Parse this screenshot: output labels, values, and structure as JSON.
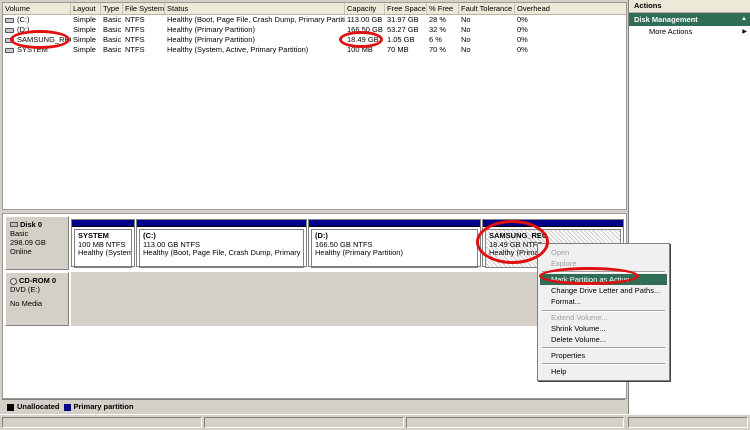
{
  "volumes_table": {
    "headers": [
      "Volume",
      "Layout",
      "Type",
      "File System",
      "Status",
      "Capacity",
      "Free Space",
      "% Free",
      "Fault Tolerance",
      "Overhead"
    ],
    "rows": [
      [
        "(C:)",
        "Simple",
        "Basic",
        "NTFS",
        "Healthy (Boot, Page File, Crash Dump, Primary Partition)",
        "113.00 GB",
        "31.97 GB",
        "28 %",
        "No",
        "0%"
      ],
      [
        "(D:)",
        "Simple",
        "Basic",
        "NTFS",
        "Healthy (Primary Partition)",
        "166.50 GB",
        "53.27 GB",
        "32 %",
        "No",
        "0%"
      ],
      [
        "SAMSUNG_REC",
        "Simple",
        "Basic",
        "NTFS",
        "Healthy (Primary Partition)",
        "18.49 GB",
        "1.05 GB",
        "6 %",
        "No",
        "0%"
      ],
      [
        "SYSTEM",
        "Simple",
        "Basic",
        "NTFS",
        "Healthy (System, Active, Primary Partition)",
        "100 MB",
        "70 MB",
        "70 %",
        "No",
        "0%"
      ]
    ]
  },
  "disk0": {
    "name": "Disk 0",
    "type": "Basic",
    "size": "298.09 GB",
    "state": "Online",
    "partitions": [
      {
        "name": "SYSTEM",
        "size": "100 MB NTFS",
        "status": "Healthy (System, A"
      },
      {
        "name": "(C:)",
        "size": "113.00 GB NTFS",
        "status": "Healthy (Boot, Page File, Crash Dump, Primary Partiti"
      },
      {
        "name": "(D:)",
        "size": "166.50 GB NTFS",
        "status": "Healthy (Primary Partition)"
      },
      {
        "name": "SAMSUNG_REC",
        "size": "18.49 GB NTFS",
        "status": "Healthy (Primary"
      }
    ]
  },
  "cdrom0": {
    "name": "CD-ROM 0",
    "type": "DVD (E:)",
    "media": "No Media"
  },
  "legend": [
    {
      "label": "Unallocated",
      "color": "#000000"
    },
    {
      "label": "Primary partition",
      "color": "#00008b"
    }
  ],
  "actions": {
    "header": "Actions",
    "section": "Disk Management",
    "more": "More Actions"
  },
  "context_menu": [
    {
      "label": "Open",
      "enabled": false
    },
    {
      "label": "Explore",
      "enabled": false
    },
    {
      "sep": true
    },
    {
      "label": "Mark Partition as Active",
      "enabled": true,
      "highlighted": true
    },
    {
      "label": "Change Drive Letter and Paths...",
      "enabled": true
    },
    {
      "label": "Format...",
      "enabled": true
    },
    {
      "sep": true
    },
    {
      "label": "Extend Volume...",
      "enabled": false
    },
    {
      "label": "Shrink Volume...",
      "enabled": true
    },
    {
      "label": "Delete Volume...",
      "enabled": true
    },
    {
      "sep": true
    },
    {
      "label": "Properties",
      "enabled": true
    },
    {
      "sep": true
    },
    {
      "label": "Help",
      "enabled": true
    }
  ],
  "colors": {
    "accent": "#2f6d55",
    "primary_partition": "#00008b",
    "highlight_ring": "#e01010"
  }
}
